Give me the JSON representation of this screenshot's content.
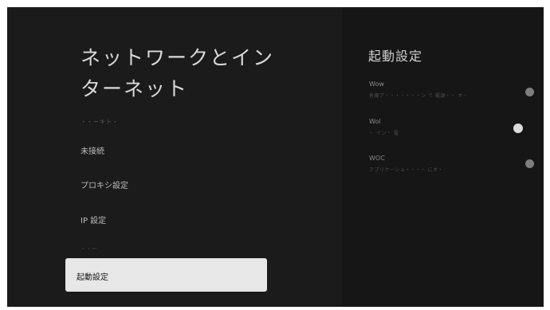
{
  "left": {
    "title_line1": "ネットワークとイン",
    "title_line2": "ターネット",
    "section_header": "・・ーキト・",
    "items": [
      "未接続",
      "プロキシ設定",
      "IP 設定",
      "・・ー"
    ],
    "selected_label": "起動設定"
  },
  "right": {
    "title": "起動設定",
    "options": [
      {
        "name": "Wow",
        "desc": "有線ア・・・・・・・ン で 電源・・ オ・ ",
        "selected": false
      },
      {
        "name": "Wol",
        "desc": "・ イン・ 電",
        "selected": true
      },
      {
        "name": "WOC",
        "desc": "アプリケーショ・・・・ にオ・",
        "selected": false
      }
    ]
  },
  "colors": {
    "background": "#1b1b1b",
    "panel": "#161616",
    "selected_bg": "#e7e7e7",
    "radio_on": "#dcdcdc",
    "radio_off": "#7e7e7e"
  }
}
